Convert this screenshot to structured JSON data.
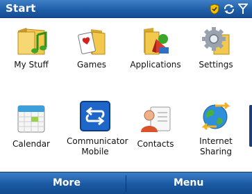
{
  "title_bar": {
    "title": "Start",
    "status_icons": [
      "shield-status-icon",
      "sync-status-icon",
      "signal-icon"
    ]
  },
  "apps": [
    {
      "label": "My Stuff",
      "icon": "folder-music-icon"
    },
    {
      "label": "Games",
      "icon": "folder-games-icon"
    },
    {
      "label": "Applications",
      "icon": "folder-applications-icon"
    },
    {
      "label": "Settings",
      "icon": "settings-gear-icon"
    },
    {
      "label": "Calendar",
      "icon": "calendar-icon"
    },
    {
      "label": "Communicator Mobile",
      "line1": "Communicator",
      "line2": "Mobile",
      "icon": "communicator-icon"
    },
    {
      "label": "Contacts",
      "icon": "contacts-card-icon"
    },
    {
      "label": "Internet Sharing",
      "line1": "Internet",
      "line2": "Sharing",
      "icon": "internet-sharing-icon"
    }
  ],
  "selected_app": "Communicator Mobile",
  "soft_keys": {
    "left": "More",
    "right": "Menu"
  },
  "colors": {
    "bar_blue": "#1f5fa8",
    "folder_yellow": "#f2c94c"
  }
}
